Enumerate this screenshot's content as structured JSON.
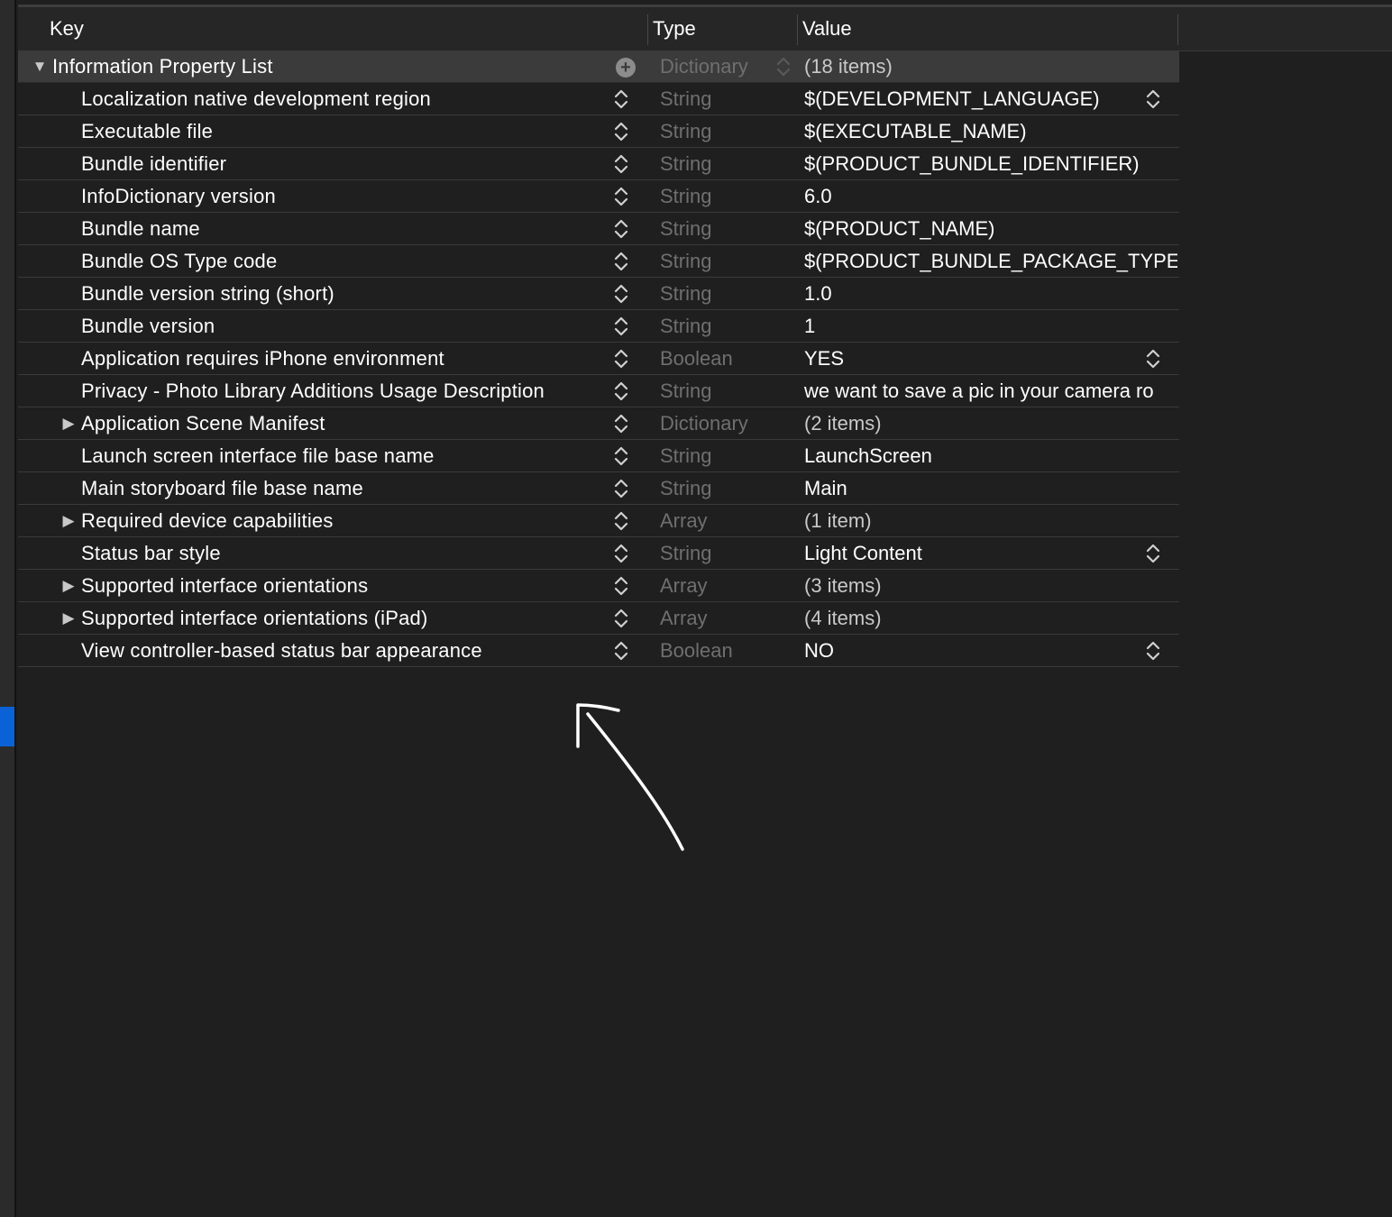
{
  "header": {
    "key_label": "Key",
    "type_label": "Type",
    "value_label": "Value"
  },
  "root": {
    "key": "Information Property List",
    "type": "Dictionary",
    "value": "(18 items)"
  },
  "rows": [
    {
      "key": "Localization native development region",
      "type": "String",
      "value": "$(DEVELOPMENT_LANGUAGE)",
      "expandable": false,
      "value_popup": true
    },
    {
      "key": "Executable file",
      "type": "String",
      "value": "$(EXECUTABLE_NAME)",
      "expandable": false,
      "value_popup": false
    },
    {
      "key": "Bundle identifier",
      "type": "String",
      "value": "$(PRODUCT_BUNDLE_IDENTIFIER)",
      "expandable": false,
      "value_popup": false
    },
    {
      "key": "InfoDictionary version",
      "type": "String",
      "value": "6.0",
      "expandable": false,
      "value_popup": false
    },
    {
      "key": "Bundle name",
      "type": "String",
      "value": "$(PRODUCT_NAME)",
      "expandable": false,
      "value_popup": false
    },
    {
      "key": "Bundle OS Type code",
      "type": "String",
      "value": "$(PRODUCT_BUNDLE_PACKAGE_TYPE)",
      "expandable": false,
      "value_popup": false
    },
    {
      "key": "Bundle version string (short)",
      "type": "String",
      "value": "1.0",
      "expandable": false,
      "value_popup": false
    },
    {
      "key": "Bundle version",
      "type": "String",
      "value": "1",
      "expandable": false,
      "value_popup": false
    },
    {
      "key": "Application requires iPhone environment",
      "type": "Boolean",
      "value": "YES",
      "expandable": false,
      "value_popup": true
    },
    {
      "key": "Privacy - Photo Library Additions Usage Description",
      "type": "String",
      "value": "we want to save a pic in your camera ro",
      "expandable": false,
      "value_popup": false
    },
    {
      "key": "Application Scene Manifest",
      "type": "Dictionary",
      "value": "(2 items)",
      "expandable": true,
      "value_popup": false
    },
    {
      "key": "Launch screen interface file base name",
      "type": "String",
      "value": "LaunchScreen",
      "expandable": false,
      "value_popup": false
    },
    {
      "key": "Main storyboard file base name",
      "type": "String",
      "value": "Main",
      "expandable": false,
      "value_popup": false
    },
    {
      "key": "Required device capabilities",
      "type": "Array",
      "value": "(1 item)",
      "expandable": true,
      "value_popup": false
    },
    {
      "key": "Status bar style",
      "type": "String",
      "value": "Light Content",
      "expandable": false,
      "value_popup": true
    },
    {
      "key": "Supported interface orientations",
      "type": "Array",
      "value": "(3 items)",
      "expandable": true,
      "value_popup": false
    },
    {
      "key": "Supported interface orientations (iPad)",
      "type": "Array",
      "value": "(4 items)",
      "expandable": true,
      "value_popup": false
    },
    {
      "key": "View controller-based status bar appearance",
      "type": "Boolean",
      "value": "NO",
      "expandable": false,
      "value_popup": true
    }
  ],
  "icons": {
    "disclosure_open": "triangle-down-icon",
    "disclosure_closed": "triangle-right-icon",
    "add": "plus-circle-icon",
    "stepper": "up-down-chevron-icon",
    "annotation": "hand-drawn-arrow-icon"
  },
  "colors": {
    "background": "#1f1f1f",
    "root_row": "#3b3b3b",
    "type_text": "#6f6f6f",
    "selection_accent": "#0a62d6"
  }
}
